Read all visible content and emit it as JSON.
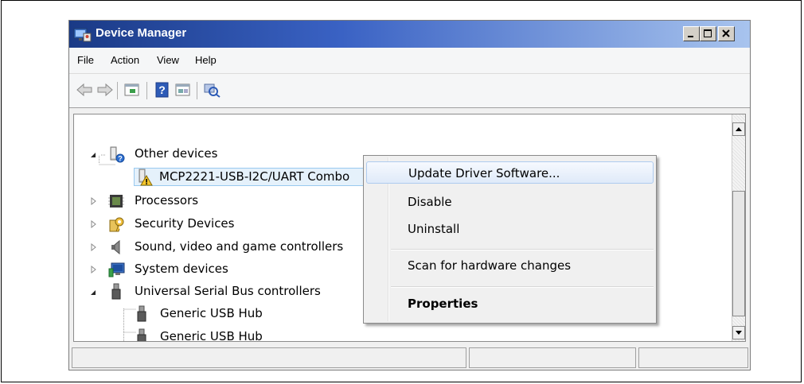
{
  "window": {
    "title": "Device Manager"
  },
  "menubar": {
    "items": [
      "File",
      "Action",
      "View",
      "Help"
    ]
  },
  "toolbar": {
    "icons": [
      "back-arrow-icon",
      "forward-arrow-icon",
      "properties-icon",
      "help-icon",
      "details-icon",
      "scan-hardware-icon"
    ]
  },
  "tree": {
    "items": [
      {
        "label": "Other devices",
        "icon": "unknown-device-icon",
        "expanded": true
      },
      {
        "label": "MCP2221-USB-I2C/UART Combo",
        "icon": "warning-device-icon",
        "selected": true
      },
      {
        "label": "Processors",
        "icon": "processor-icon"
      },
      {
        "label": "Security Devices",
        "icon": "security-key-icon"
      },
      {
        "label": "Sound, video and game controllers",
        "icon": "speaker-icon"
      },
      {
        "label": "System devices",
        "icon": "computer-icon"
      },
      {
        "label": "Universal Serial Bus controllers",
        "icon": "usb-icon",
        "expanded": true
      },
      {
        "label": "Generic USB Hub",
        "icon": "usb-icon"
      },
      {
        "label": "Generic USB Hub",
        "icon": "usb-icon"
      }
    ]
  },
  "context_menu": {
    "items": [
      {
        "label": "Update Driver Software...",
        "highlighted": true
      },
      {
        "label": "Disable"
      },
      {
        "label": "Uninstall"
      },
      {
        "label": "Scan for hardware changes"
      },
      {
        "label": "Properties",
        "bold": true
      }
    ]
  },
  "colors": {
    "titlebar_dark": "#1a3a86",
    "titlebar_light": "#a8c4ee",
    "highlight_border": "#aecbef"
  }
}
